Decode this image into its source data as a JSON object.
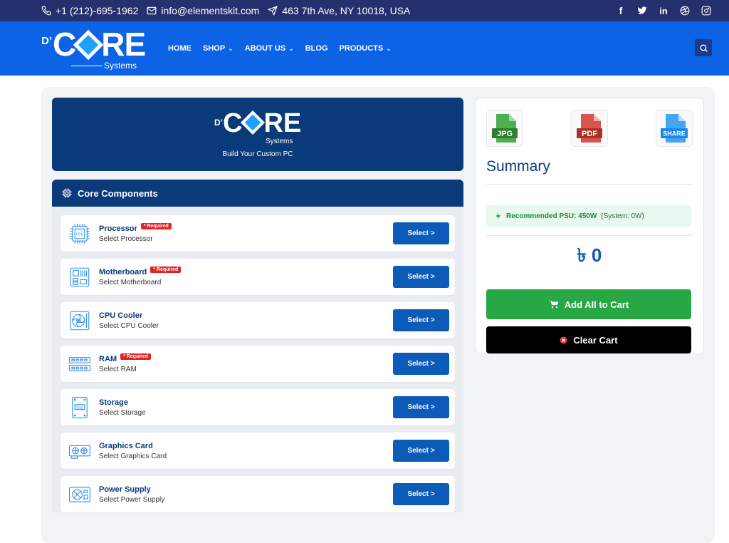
{
  "topbar": {
    "phone": "+1 (212)-695-1962",
    "email": "info@elementskit.com",
    "address": "463 7th Ave, NY 10018, USA",
    "social": [
      "f",
      "t",
      "in",
      "dribbble",
      "instagram"
    ]
  },
  "brand": {
    "prefix": "D’",
    "name_left": "C",
    "name_right": "RE",
    "sub": "Systems",
    "accent": "#1ea0ff"
  },
  "nav": [
    {
      "label": "HOME",
      "dropdown": false
    },
    {
      "label": "SHOP",
      "dropdown": true
    },
    {
      "label": "ABOUT US",
      "dropdown": true
    },
    {
      "label": "BLOG",
      "dropdown": false
    },
    {
      "label": "PRODUCTS",
      "dropdown": true
    }
  ],
  "hero": {
    "tagline": "Build Your Custom PC"
  },
  "components": {
    "title": "Core Components",
    "required_label": "* Required",
    "select_label": "Select >",
    "items": [
      {
        "name": "Processor",
        "sub": "Select Processor",
        "required": true,
        "icon": "cpu-icon"
      },
      {
        "name": "Motherboard",
        "sub": "Select Motherboard",
        "required": true,
        "icon": "motherboard-icon"
      },
      {
        "name": "CPU Cooler",
        "sub": "Select CPU Cooler",
        "required": false,
        "icon": "cooler-icon"
      },
      {
        "name": "RAM",
        "sub": "Select RAM",
        "required": true,
        "icon": "ram-icon"
      },
      {
        "name": "Storage",
        "sub": "Select Storage",
        "required": false,
        "icon": "ssd-icon"
      },
      {
        "name": "Graphics Card",
        "sub": "Select Graphics Card",
        "required": false,
        "icon": "gpu-icon"
      },
      {
        "name": "Power Supply",
        "sub": "Select Power Supply",
        "required": false,
        "icon": "psu-icon"
      }
    ]
  },
  "summary": {
    "title": "Summary",
    "exports": [
      {
        "label": "JPG",
        "color": "#2e9e44"
      },
      {
        "label": "PDF",
        "color": "#c0392b"
      },
      {
        "label": "SHARE",
        "color": "#2f8fe8"
      }
    ],
    "psu_label": "Recommended PSU: 450W",
    "psu_system": "(System: 0W)",
    "total": "৳ 0",
    "add_all": "Add All to Cart",
    "clear": "Clear Cart"
  }
}
